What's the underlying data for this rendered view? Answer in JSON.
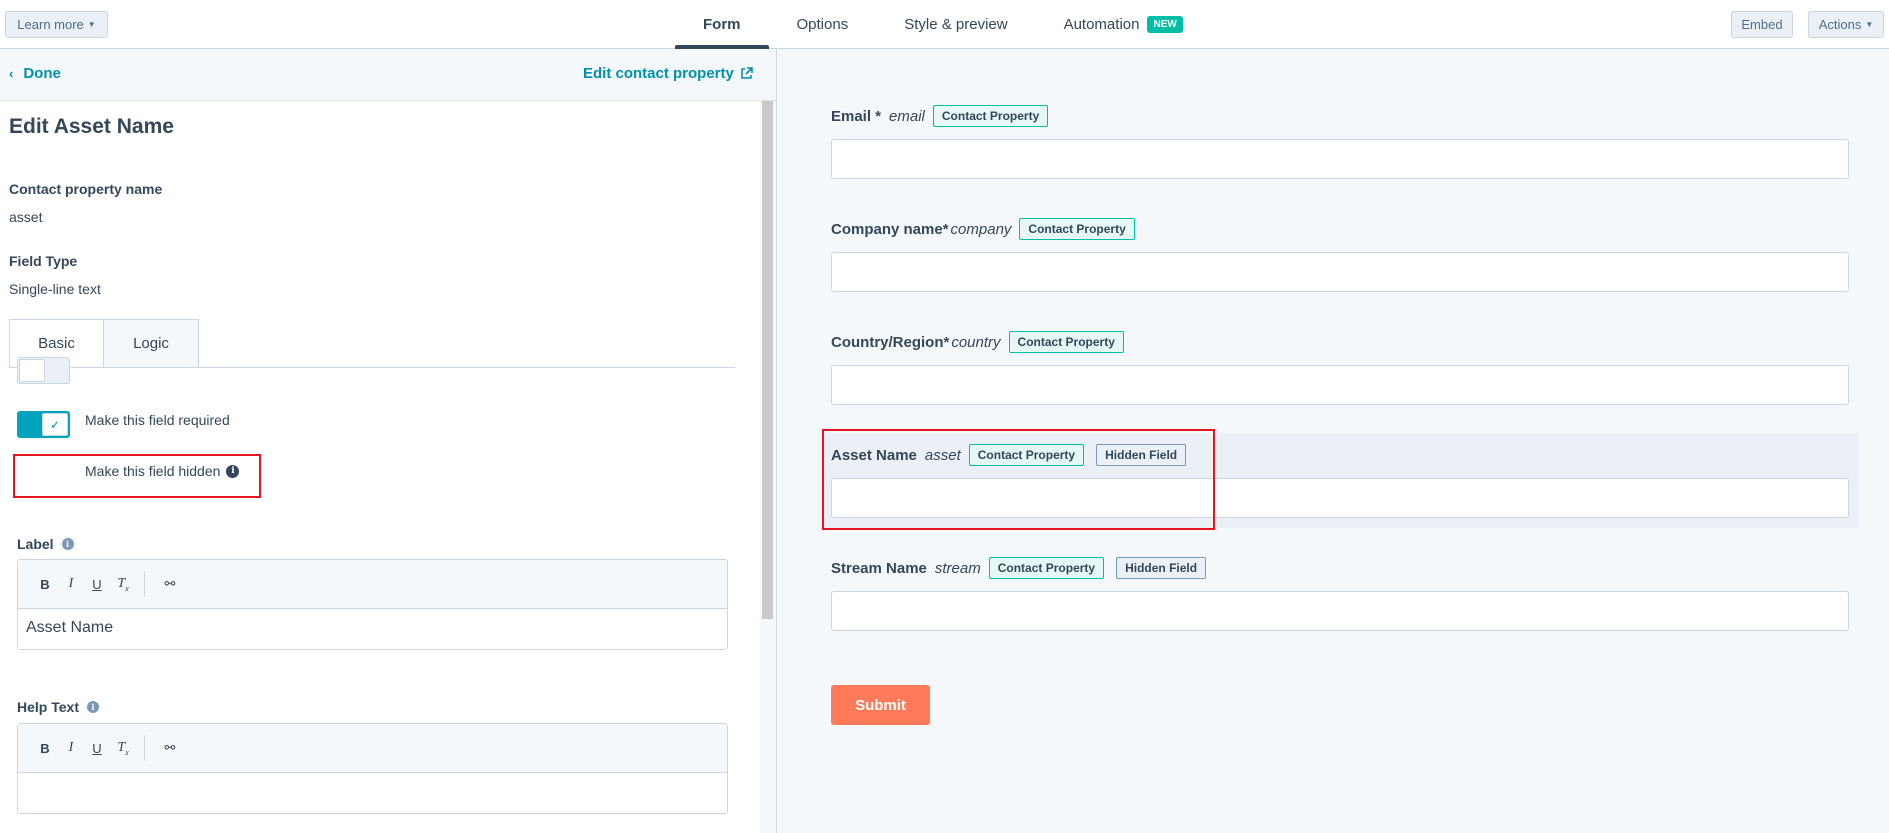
{
  "topbar": {
    "learn_more": "Learn more",
    "tabs": [
      {
        "label": "Form"
      },
      {
        "label": "Options"
      },
      {
        "label": "Style & preview"
      },
      {
        "label": "Automation"
      }
    ],
    "new_badge": "NEW",
    "embed": "Embed",
    "actions": "Actions"
  },
  "left": {
    "done": "Done",
    "edit_contact_property": "Edit contact property",
    "title": "Edit Asset Name",
    "contact_property_name_label": "Contact property name",
    "contact_property_name_value": "asset",
    "field_type_label": "Field Type",
    "field_type_value": "Single-line text",
    "subtabs": [
      {
        "label": "Basic"
      },
      {
        "label": "Logic"
      }
    ],
    "required_toggle_label": "Make this field required",
    "required_on": false,
    "hidden_toggle_label": "Make this field hidden",
    "hidden_on": true,
    "label_heading": "Label",
    "label_value": "Asset Name",
    "help_text_heading": "Help Text",
    "help_text_value": ""
  },
  "preview": {
    "fields": [
      {
        "label": "Email *",
        "name": "email",
        "tags": [
          "Contact Property"
        ]
      },
      {
        "label": "Company name*",
        "name": "company",
        "tags": [
          "Contact Property"
        ]
      },
      {
        "label": "Country/Region*",
        "name": "country",
        "tags": [
          "Contact Property"
        ]
      },
      {
        "label": "Asset Name",
        "name": "asset",
        "tags": [
          "Contact Property",
          "Hidden Field"
        ]
      },
      {
        "label": "Stream Name",
        "name": "stream",
        "tags": [
          "Contact Property",
          "Hidden Field"
        ]
      }
    ],
    "submit": "Submit"
  },
  "colors": {
    "accent_link": "#0091ae",
    "toggle_on": "#00a4bd",
    "submit": "#ff7a59",
    "contact_property_tag": "#00bda5",
    "highlight_box": "#e6141e"
  }
}
